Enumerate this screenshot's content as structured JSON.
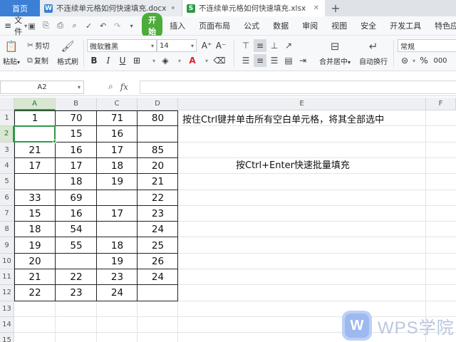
{
  "tabs": {
    "home": "首页",
    "doc": {
      "badge": "W",
      "badge_color": "#3b7fd6",
      "label": "不连续单元格如何快速填充.docx",
      "close": "•"
    },
    "xls": {
      "badge": "S",
      "badge_color": "#2e9a47",
      "label": "不连续单元格如何快速填充.xlsx",
      "close": "✕"
    },
    "add": "+"
  },
  "menubar": {
    "file": "文件",
    "start": "开始",
    "items": [
      "插入",
      "页面布局",
      "公式",
      "数据",
      "审阅",
      "视图",
      "安全",
      "开发工具",
      "特色应用"
    ]
  },
  "ribbon": {
    "paste": "粘贴",
    "cut": "剪切",
    "copy": "复制",
    "format_painter": "格式刷",
    "font_name": "微软雅黑",
    "font_size": "14",
    "merge": "合并居中",
    "wrap": "自动换行",
    "number_format": "常规",
    "bold": "B",
    "italic": "I",
    "underline": "U",
    "font_color_a": "A",
    "percent": "%",
    "thousands": "000"
  },
  "formula_bar": {
    "name_box": "A2",
    "fx": "fx",
    "formula": ""
  },
  "columns": [
    "A",
    "B",
    "C",
    "D",
    "E",
    "F"
  ],
  "rows": [
    "1",
    "2",
    "3",
    "4",
    "5",
    "6",
    "7",
    "8",
    "9",
    "10",
    "11",
    "12",
    "13",
    "14",
    "15"
  ],
  "selection": {
    "column": "A",
    "row": "2"
  },
  "cells": [
    [
      "1",
      "70",
      "71",
      "80"
    ],
    [
      "",
      "15",
      "16",
      ""
    ],
    [
      "21",
      "16",
      "17",
      "85"
    ],
    [
      "17",
      "17",
      "18",
      "20"
    ],
    [
      "",
      "18",
      "19",
      "21"
    ],
    [
      "33",
      "69",
      "",
      "22"
    ],
    [
      "15",
      "16",
      "17",
      "23"
    ],
    [
      "18",
      "54",
      "",
      "24"
    ],
    [
      "19",
      "55",
      "18",
      "25"
    ],
    [
      "20",
      "",
      "19",
      "26"
    ],
    [
      "21",
      "22",
      "23",
      "24"
    ],
    [
      "22",
      "23",
      "24",
      ""
    ]
  ],
  "notes": {
    "line1": "按住Ctrl键并单击所有空白单元格，将其全部选中",
    "line2": "按Ctrl+Enter快速批量填充"
  },
  "logo": {
    "mark": "W",
    "text": "WPS学院"
  },
  "colors": {
    "accent_green": "#2e9a47",
    "home_tab": "#3b7fd6",
    "start_button": "#4dac3a"
  }
}
